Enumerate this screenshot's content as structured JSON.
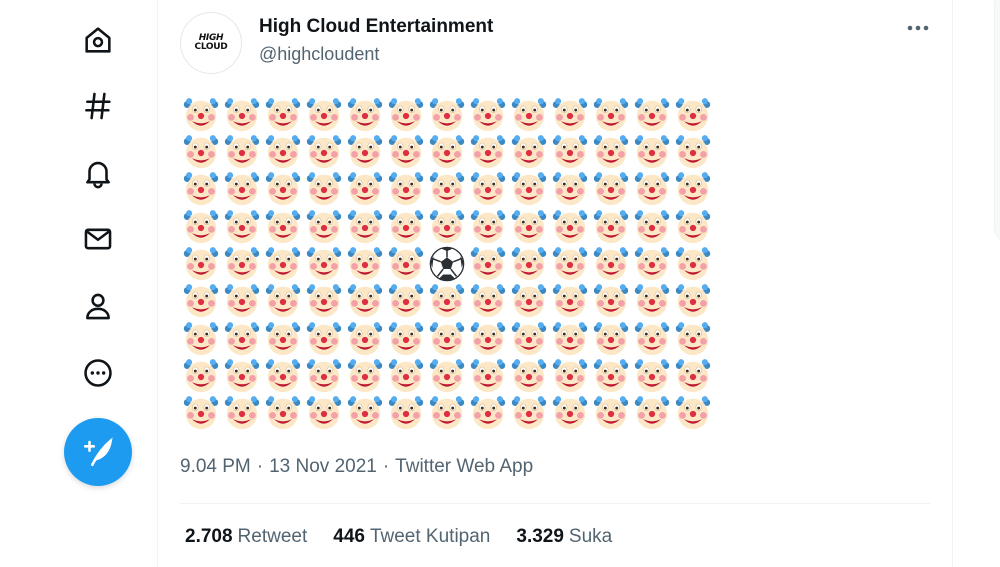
{
  "nav": {
    "items": [
      {
        "name": "home-icon"
      },
      {
        "name": "hashtag-icon"
      },
      {
        "name": "bell-icon"
      },
      {
        "name": "mail-icon"
      },
      {
        "name": "profile-icon"
      },
      {
        "name": "more-circle-icon"
      }
    ],
    "compose_icon": "feather-plus-icon",
    "accent_color": "#1d9bf0"
  },
  "tweet": {
    "author": {
      "display_name": "High Cloud Entertainment",
      "handle": "@highcloudent",
      "avatar_logo_lines": [
        "HIGH",
        "CLOUD"
      ]
    },
    "more_icon": "ellipsis-icon",
    "emoji_grid": {
      "rows": 9,
      "cols": 13,
      "fill_emoji": "clown-face",
      "odd_emoji": "soccer-ball",
      "odd_position": {
        "row": 5,
        "col": 7
      }
    },
    "time": "9.04 PM",
    "date": "13 Nov 2021",
    "source": "Twitter Web App",
    "stats": [
      {
        "count": "2.708",
        "label": "Retweet"
      },
      {
        "count": "446",
        "label": "Tweet Kutipan"
      },
      {
        "count": "3.329",
        "label": "Suka"
      }
    ]
  }
}
